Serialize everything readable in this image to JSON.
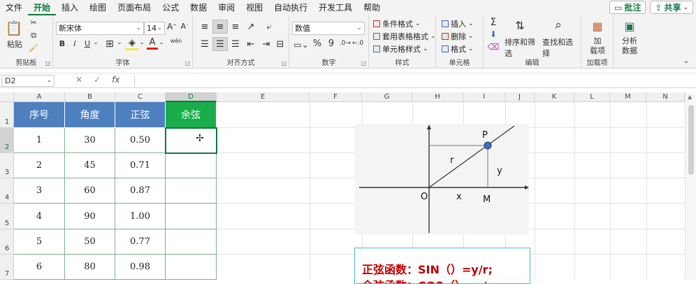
{
  "menu": {
    "tabs": [
      "文件",
      "开始",
      "插入",
      "绘图",
      "页面布局",
      "公式",
      "数据",
      "审阅",
      "视图",
      "自动执行",
      "开发工具",
      "帮助"
    ],
    "active_tab": "开始",
    "comment_label": "批注",
    "share_label": "共享"
  },
  "ribbon": {
    "clipboard": {
      "paste": "粘贴",
      "label": "剪贴板"
    },
    "font": {
      "name": "新宋体",
      "size": "14",
      "bold": "B",
      "italic": "I",
      "underline": "U",
      "wen": "wén",
      "label": "字体"
    },
    "alignment": {
      "label": "对齐方式"
    },
    "number": {
      "format": "数值",
      "percent": "%",
      "comma": "9",
      "label": "数字"
    },
    "styles": {
      "conditional": "条件格式",
      "table": "套用表格格式",
      "cell": "单元格样式",
      "label": "样式"
    },
    "cells": {
      "insert": "插入",
      "delete": "删除",
      "format": "格式",
      "label": "单元格"
    },
    "editing": {
      "sort": "排序和筛选",
      "find": "查找和选择",
      "label": "编辑"
    },
    "addins": {
      "addin_line1": "加",
      "addin_line2": "载项",
      "label": "加载项"
    },
    "analysis": {
      "line1": "分析",
      "line2": "数据"
    }
  },
  "formula_bar": {
    "name_box": "D2",
    "fx": "fx",
    "value": ""
  },
  "columns": [
    "A",
    "B",
    "C",
    "D",
    "E",
    "F",
    "G",
    "H",
    "I",
    "J",
    "K",
    "L",
    "M",
    "N"
  ],
  "rows": [
    "1",
    "2",
    "3",
    "4",
    "5",
    "6",
    "7"
  ],
  "table": {
    "headers": [
      "序号",
      "角度",
      "正弦",
      "余弦"
    ],
    "header_colors": [
      "#4e80c0",
      "#4e80c0",
      "#4e80c0",
      "#1aad4b"
    ],
    "rows": [
      [
        "1",
        "30",
        "0.50",
        ""
      ],
      [
        "2",
        "45",
        "0.71",
        ""
      ],
      [
        "3",
        "60",
        "0.87",
        ""
      ],
      [
        "4",
        "90",
        "1.00",
        ""
      ],
      [
        "5",
        "50",
        "0.77",
        ""
      ],
      [
        "6",
        "80",
        "0.98",
        ""
      ]
    ]
  },
  "diagram": {
    "labels": {
      "P": "P",
      "r": "r",
      "y": "y",
      "O": "O",
      "x": "x",
      "M": "M"
    }
  },
  "note": {
    "line1": "正弦函数：SIN（）=y/r;",
    "line2": "余弦函数：COS（）=x/r;"
  },
  "colors": {
    "accent": "#0e7a3d",
    "text_red": "#c00000",
    "point_fill": "#3c6fbf"
  }
}
